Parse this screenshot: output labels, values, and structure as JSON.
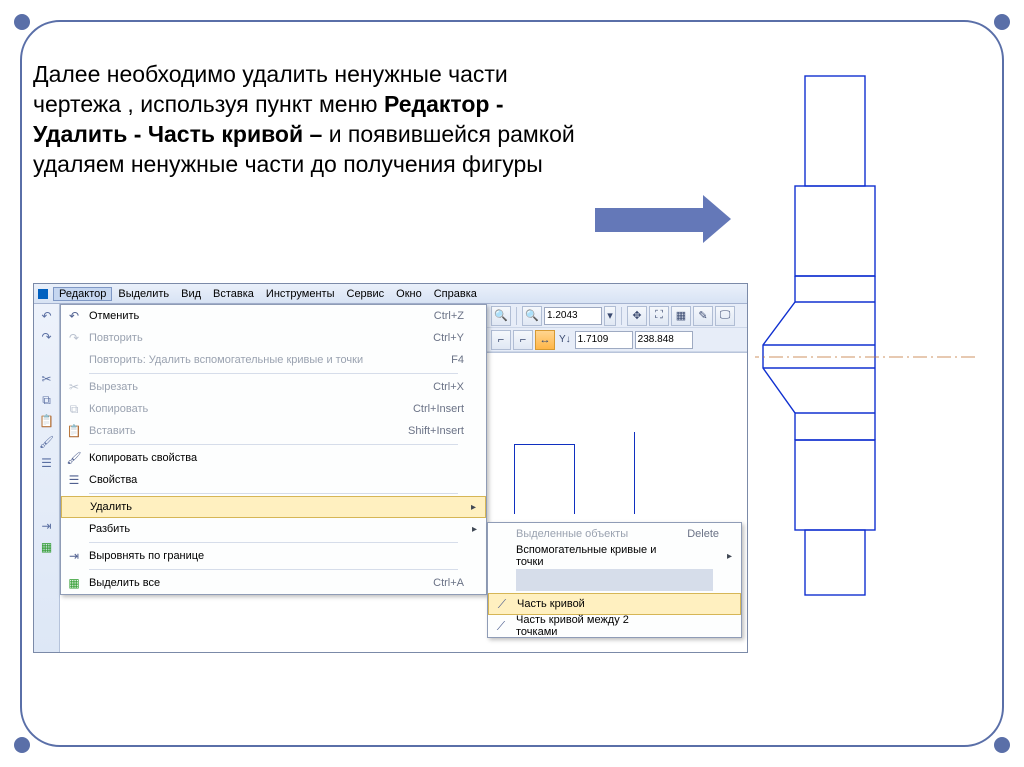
{
  "instruction": {
    "text1": "Далее необходимо удалить ненужные части чертежа , используя пункт меню ",
    "bold1": "Редактор - Удалить  - Часть кривой – ",
    "text2": "и появившейся рамкой удаляем ненужные части до получения  фигуры"
  },
  "menubar": [
    "Редактор",
    "Выделить",
    "Вид",
    "Вставка",
    "Инструменты",
    "Сервис",
    "Окно",
    "Справка"
  ],
  "menu": {
    "undo": {
      "label": "Отменить",
      "short": "Ctrl+Z"
    },
    "redo": {
      "label": "Повторить",
      "short": "Ctrl+Y"
    },
    "repeat": {
      "label": "Повторить: Удалить вспомогательные кривые и точки",
      "short": "F4"
    },
    "cut": {
      "label": "Вырезать",
      "short": "Ctrl+X"
    },
    "copy": {
      "label": "Копировать",
      "short": "Ctrl+Insert"
    },
    "paste": {
      "label": "Вставить",
      "short": "Shift+Insert"
    },
    "copyprops": {
      "label": "Копировать свойства",
      "short": ""
    },
    "props": {
      "label": "Свойства",
      "short": ""
    },
    "delete": {
      "label": "Удалить",
      "short": ""
    },
    "split": {
      "label": "Разбить",
      "short": ""
    },
    "align": {
      "label": "Выровнять по границе",
      "short": ""
    },
    "selectall": {
      "label": "Выделить все",
      "short": "Ctrl+A"
    }
  },
  "submenu": {
    "selected": {
      "label": "Выделенные объекты",
      "short": "Delete"
    },
    "aux": {
      "label": "Вспомогательные кривые и точки"
    },
    "curvepart": {
      "label": "Часть кривой"
    },
    "curvepart2": {
      "label": "Часть кривой между 2 точками"
    }
  },
  "toolbar": {
    "zoom_value": "1.2043",
    "y_label": "Y↓",
    "y_value": "1.7109",
    "coord2": "238.848"
  }
}
